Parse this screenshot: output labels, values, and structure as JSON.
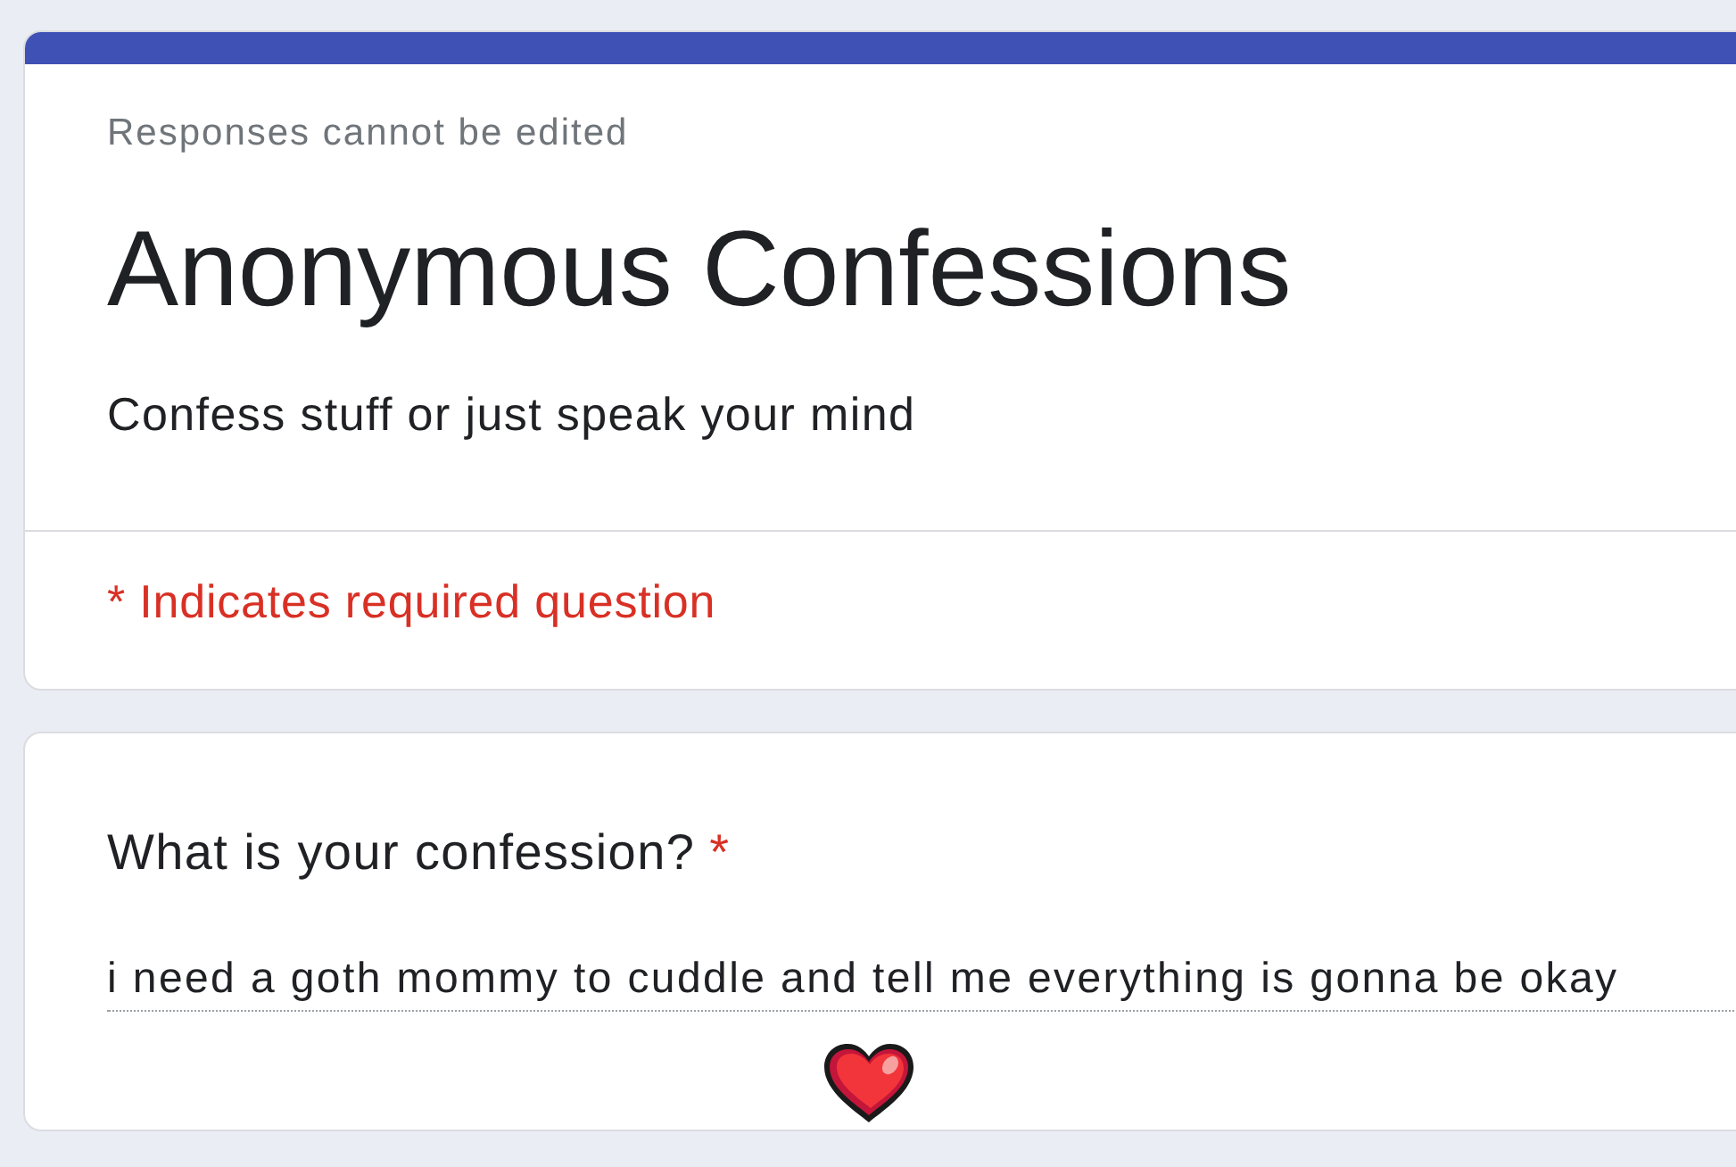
{
  "form": {
    "notice": "Responses cannot be edited",
    "title": "Anonymous Confessions",
    "description": "Confess stuff or just speak your mind",
    "required_note": "* Indicates required question"
  },
  "questions": [
    {
      "label": "What is your confession?",
      "required_mark": "*",
      "answer": "i need a goth mommy to cuddle and tell me everything is gonna be okay"
    }
  ]
}
